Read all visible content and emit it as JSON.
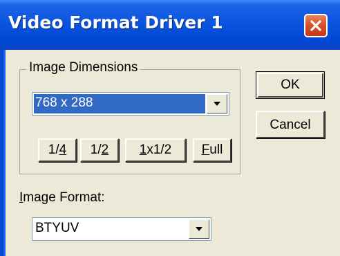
{
  "window": {
    "title": "Video Format Driver 1",
    "close_icon": "close-icon"
  },
  "dimensions_group": {
    "legend": "Image Dimensions",
    "select": {
      "value": "768 x 288",
      "dropdown_icon": "chevron-down-icon"
    },
    "size_buttons": [
      {
        "pre": "1/",
        "mn": "4",
        "post": ""
      },
      {
        "pre": "1/",
        "mn": "2",
        "post": ""
      },
      {
        "pre": "",
        "mn": "1",
        "post": "x1/2"
      },
      {
        "pre": "",
        "mn": "F",
        "post": "ull"
      }
    ]
  },
  "format": {
    "label_mnemonic": "I",
    "label_rest": "mage Format:",
    "select": {
      "value": "BTYUV",
      "dropdown_icon": "chevron-down-icon"
    }
  },
  "actions": {
    "ok_label": "OK",
    "cancel_label": "Cancel"
  },
  "colors": {
    "titlebar": "#0a56e0",
    "dialog_bg": "#ece9d8",
    "selection": "#316ac5",
    "close_button": "#d6542d"
  }
}
